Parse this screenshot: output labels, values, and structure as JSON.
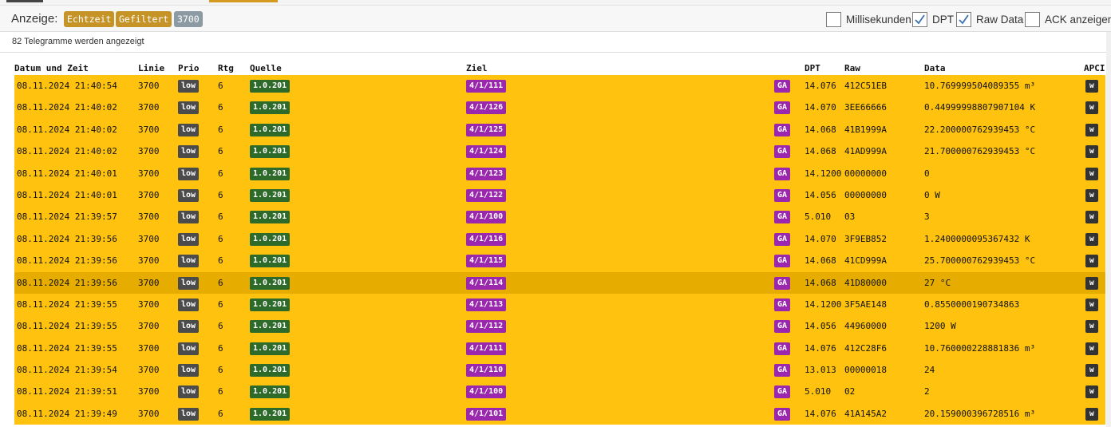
{
  "toolbar": {
    "label": "Anzeige:",
    "badges": [
      "Echtzeit",
      "Gefiltert",
      "3700"
    ],
    "options": [
      {
        "label": "Millisekunden",
        "checked": false
      },
      {
        "label": "DPT",
        "checked": true
      },
      {
        "label": "Raw Data",
        "checked": true
      },
      {
        "label": "ACK anzeigen",
        "checked": false
      }
    ]
  },
  "info": {
    "text": "82 Telegramme werden angezeigt"
  },
  "table": {
    "headers": {
      "datetime": "Datum und Zeit",
      "line": "Linie",
      "prio": "Prio",
      "rtg": "Rtg",
      "source": "Quelle",
      "target": "Ziel",
      "dpt": "DPT",
      "raw": "Raw",
      "data": "Data",
      "apci": "APCI"
    },
    "rows": [
      {
        "datetime": "08.11.2024 21:40:54",
        "line": "3700",
        "prio": "low",
        "rtg": "6",
        "source": "1.0.201",
        "target": "4/1/111",
        "type": "GA",
        "dpt": "14.076",
        "raw": "412C51EB",
        "data": "10.769999504089355 m³",
        "apci": "w"
      },
      {
        "datetime": "08.11.2024 21:40:02",
        "line": "3700",
        "prio": "low",
        "rtg": "6",
        "source": "1.0.201",
        "target": "4/1/126",
        "type": "GA",
        "dpt": "14.070",
        "raw": "3EE66666",
        "data": "0.44999998807907104 K",
        "apci": "w"
      },
      {
        "datetime": "08.11.2024 21:40:02",
        "line": "3700",
        "prio": "low",
        "rtg": "6",
        "source": "1.0.201",
        "target": "4/1/125",
        "type": "GA",
        "dpt": "14.068",
        "raw": "41B1999A",
        "data": "22.200000762939453 °C",
        "apci": "w"
      },
      {
        "datetime": "08.11.2024 21:40:02",
        "line": "3700",
        "prio": "low",
        "rtg": "6",
        "source": "1.0.201",
        "target": "4/1/124",
        "type": "GA",
        "dpt": "14.068",
        "raw": "41AD999A",
        "data": "21.700000762939453 °C",
        "apci": "w"
      },
      {
        "datetime": "08.11.2024 21:40:01",
        "line": "3700",
        "prio": "low",
        "rtg": "6",
        "source": "1.0.201",
        "target": "4/1/123",
        "type": "GA",
        "dpt": "14.1200",
        "raw": "00000000",
        "data": "0",
        "apci": "w"
      },
      {
        "datetime": "08.11.2024 21:40:01",
        "line": "3700",
        "prio": "low",
        "rtg": "6",
        "source": "1.0.201",
        "target": "4/1/122",
        "type": "GA",
        "dpt": "14.056",
        "raw": "00000000",
        "data": "0 W",
        "apci": "w"
      },
      {
        "datetime": "08.11.2024 21:39:57",
        "line": "3700",
        "prio": "low",
        "rtg": "6",
        "source": "1.0.201",
        "target": "4/1/100",
        "type": "GA",
        "dpt": "5.010",
        "raw": "03",
        "data": "3",
        "apci": "w"
      },
      {
        "datetime": "08.11.2024 21:39:56",
        "line": "3700",
        "prio": "low",
        "rtg": "6",
        "source": "1.0.201",
        "target": "4/1/116",
        "type": "GA",
        "dpt": "14.070",
        "raw": "3F9EB852",
        "data": "1.2400000095367432 K",
        "apci": "w"
      },
      {
        "datetime": "08.11.2024 21:39:56",
        "line": "3700",
        "prio": "low",
        "rtg": "6",
        "source": "1.0.201",
        "target": "4/1/115",
        "type": "GA",
        "dpt": "14.068",
        "raw": "41CD999A",
        "data": "25.700000762939453 °C",
        "apci": "w"
      },
      {
        "datetime": "08.11.2024 21:39:56",
        "line": "3700",
        "prio": "low",
        "rtg": "6",
        "source": "1.0.201",
        "target": "4/1/114",
        "type": "GA",
        "dpt": "14.068",
        "raw": "41D80000",
        "data": "27 °C",
        "apci": "w",
        "highlight": true
      },
      {
        "datetime": "08.11.2024 21:39:55",
        "line": "3700",
        "prio": "low",
        "rtg": "6",
        "source": "1.0.201",
        "target": "4/1/113",
        "type": "GA",
        "dpt": "14.1200",
        "raw": "3F5AE148",
        "data": "0.8550000190734863",
        "apci": "w"
      },
      {
        "datetime": "08.11.2024 21:39:55",
        "line": "3700",
        "prio": "low",
        "rtg": "6",
        "source": "1.0.201",
        "target": "4/1/112",
        "type": "GA",
        "dpt": "14.056",
        "raw": "44960000",
        "data": "1200 W",
        "apci": "w"
      },
      {
        "datetime": "08.11.2024 21:39:55",
        "line": "3700",
        "prio": "low",
        "rtg": "6",
        "source": "1.0.201",
        "target": "4/1/111",
        "type": "GA",
        "dpt": "14.076",
        "raw": "412C28F6",
        "data": "10.760000228881836 m³",
        "apci": "w"
      },
      {
        "datetime": "08.11.2024 21:39:54",
        "line": "3700",
        "prio": "low",
        "rtg": "6",
        "source": "1.0.201",
        "target": "4/1/110",
        "type": "GA",
        "dpt": "13.013",
        "raw": "00000018",
        "data": "24",
        "apci": "w"
      },
      {
        "datetime": "08.11.2024 21:39:51",
        "line": "3700",
        "prio": "low",
        "rtg": "6",
        "source": "1.0.201",
        "target": "4/1/100",
        "type": "GA",
        "dpt": "5.010",
        "raw": "02",
        "data": "2",
        "apci": "w"
      },
      {
        "datetime": "08.11.2024 21:39:49",
        "line": "3700",
        "prio": "low",
        "rtg": "6",
        "source": "1.0.201",
        "target": "4/1/101",
        "type": "GA",
        "dpt": "14.076",
        "raw": "41A145A2",
        "data": "20.159000396728516 m³",
        "apci": "w"
      }
    ]
  }
}
